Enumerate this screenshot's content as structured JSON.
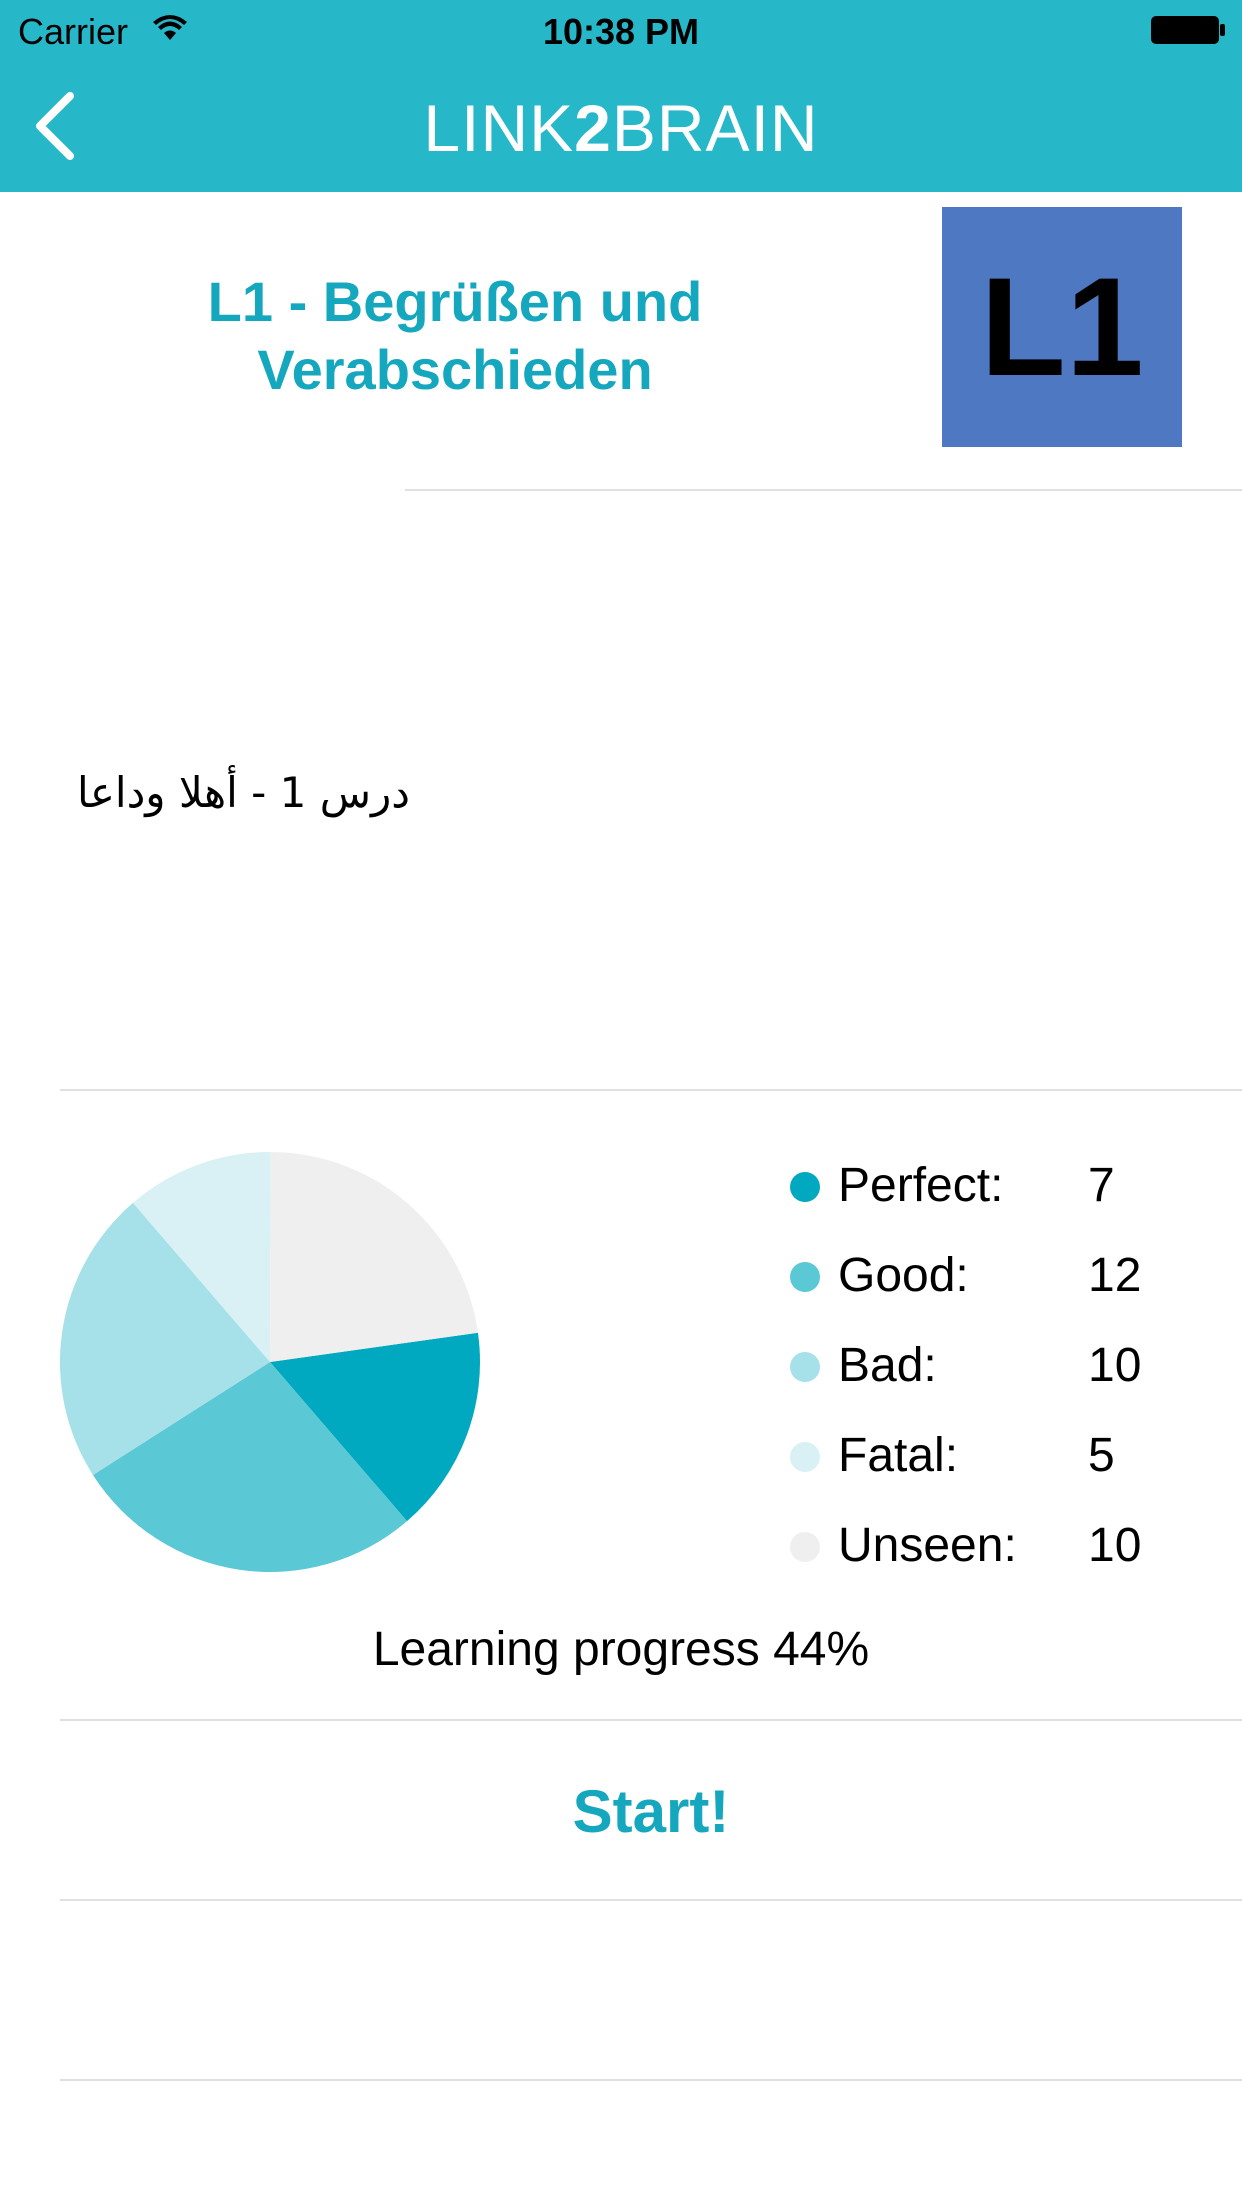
{
  "status_bar": {
    "carrier": "Carrier",
    "time": "10:38 PM"
  },
  "nav": {
    "logo_prefix": "LINK",
    "logo_two": "2",
    "logo_suffix": "BRAIN"
  },
  "lesson": {
    "title_line1": "L1 - Begrüßen und",
    "title_line2": "Verabschieden",
    "badge": "L1",
    "badge_color": "#4f78c3",
    "translation": "درس 1 - أهلا وداعا"
  },
  "chart_data": {
    "type": "pie",
    "categories": [
      "Perfect",
      "Good",
      "Bad",
      "Fatal",
      "Unseen"
    ],
    "values": [
      7,
      12,
      10,
      5,
      10
    ],
    "colors": [
      "#00a9c0",
      "#5ac8d5",
      "#a6e0e8",
      "#d9f1f5",
      "#efefef"
    ],
    "legend_placement": "right"
  },
  "legend": {
    "items": [
      {
        "label": "Perfect:",
        "value": "7"
      },
      {
        "label": "Good:",
        "value": "12"
      },
      {
        "label": "Bad:",
        "value": "10"
      },
      {
        "label": "Fatal:",
        "value": "5"
      },
      {
        "label": "Unseen:",
        "value": "10"
      }
    ]
  },
  "progress": {
    "text": "Learning progress 44%"
  },
  "actions": {
    "start_label": "Start!"
  },
  "theme": {
    "accent": "#26b8c9",
    "title_color": "#15a7bd"
  }
}
